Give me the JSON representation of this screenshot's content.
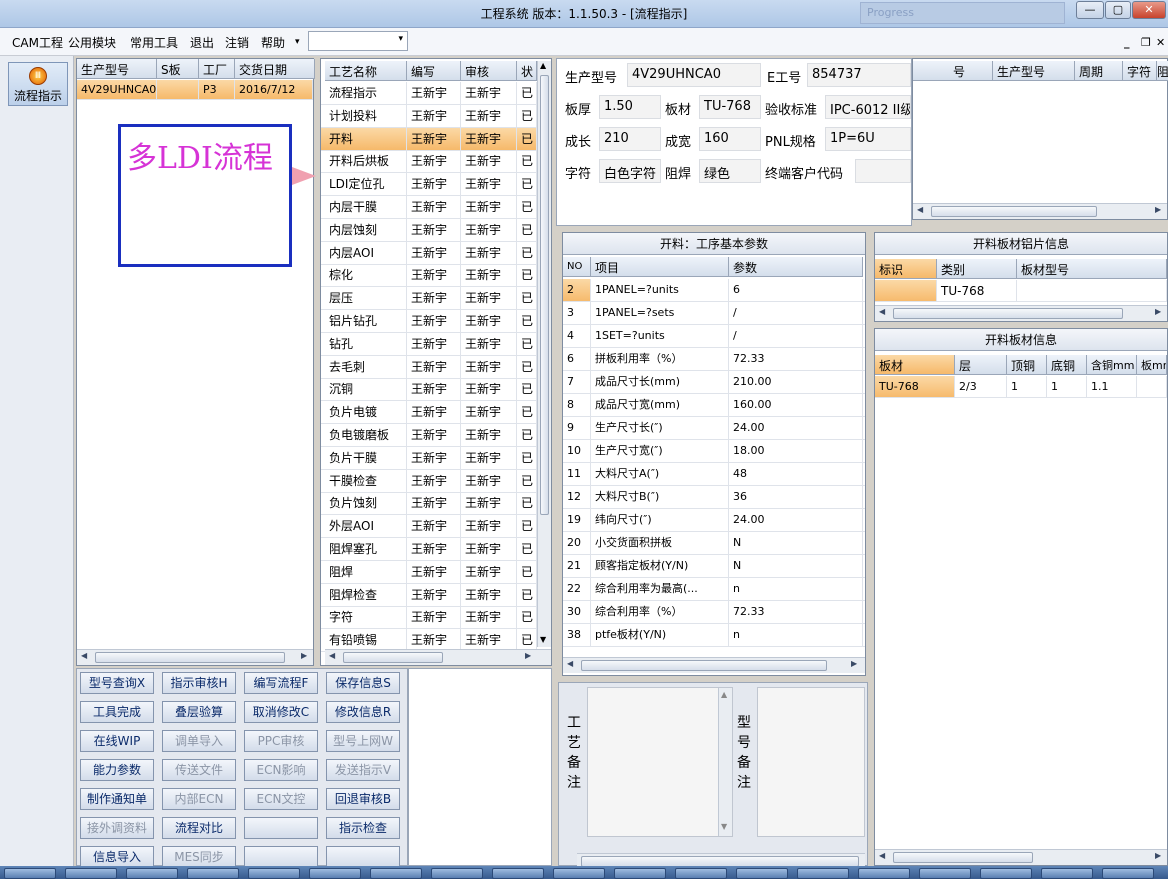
{
  "window": {
    "title": "工程系统   版本：1.1.50.3 - [流程指示]",
    "ghost_title": "Progress",
    "min": "—",
    "max": "▢",
    "close": "✕"
  },
  "menu": {
    "items": [
      "CAM工程",
      "公用模块",
      "常用工具",
      "退出",
      "注销",
      "帮助"
    ],
    "dropdown_arrow": "▾",
    "mdi_min": "_",
    "mdi_restore": "❐",
    "mdi_close": "✕"
  },
  "leftbar": {
    "flow_btn": "流程指示",
    "icon": "flow-indicator-icon"
  },
  "order_table": {
    "headers": [
      "生产型号",
      "S板",
      "工厂",
      "交货日期"
    ],
    "rows": [
      [
        "4V29UHNCA0",
        "",
        "P3",
        "2016/7/12"
      ]
    ]
  },
  "note_box": {
    "text": "多LDI流程"
  },
  "process_table": {
    "headers": [
      "工艺名称",
      "编写",
      "审核",
      "状"
    ],
    "rows": [
      [
        "流程指示",
        "王新宇",
        "王新宇",
        "已"
      ],
      [
        "计划投料",
        "王新宇",
        "王新宇",
        "已"
      ],
      [
        "开料",
        "王新宇",
        "王新宇",
        "已"
      ],
      [
        "开料后烘板",
        "王新宇",
        "王新宇",
        "已"
      ],
      [
        "LDI定位孔",
        "王新宇",
        "王新宇",
        "已"
      ],
      [
        "内层干膜",
        "王新宇",
        "王新宇",
        "已"
      ],
      [
        "内层蚀刻",
        "王新宇",
        "王新宇",
        "已"
      ],
      [
        "内层AOI",
        "王新宇",
        "王新宇",
        "已"
      ],
      [
        "棕化",
        "王新宇",
        "王新宇",
        "已"
      ],
      [
        "层压",
        "王新宇",
        "王新宇",
        "已"
      ],
      [
        "铝片钻孔",
        "王新宇",
        "王新宇",
        "已"
      ],
      [
        "钻孔",
        "王新宇",
        "王新宇",
        "已"
      ],
      [
        "去毛刺",
        "王新宇",
        "王新宇",
        "已"
      ],
      [
        "沉铜",
        "王新宇",
        "王新宇",
        "已"
      ],
      [
        "负片电镀",
        "王新宇",
        "王新宇",
        "已"
      ],
      [
        "负电镀磨板",
        "王新宇",
        "王新宇",
        "已"
      ],
      [
        "负片干膜",
        "王新宇",
        "王新宇",
        "已"
      ],
      [
        "干膜检查",
        "王新宇",
        "王新宇",
        "已"
      ],
      [
        "负片蚀刻",
        "王新宇",
        "王新宇",
        "已"
      ],
      [
        "外层AOI",
        "王新宇",
        "王新宇",
        "已"
      ],
      [
        "阻焊塞孔",
        "王新宇",
        "王新宇",
        "已"
      ],
      [
        "阻焊",
        "王新宇",
        "王新宇",
        "已"
      ],
      [
        "阻焊检查",
        "王新宇",
        "王新宇",
        "已"
      ],
      [
        "字符",
        "王新宇",
        "王新宇",
        "已"
      ],
      [
        "有铅喷锡",
        "王新宇",
        "王新宇",
        "已"
      ]
    ],
    "selected": 2
  },
  "buttons": [
    {
      "label": "型号查询X",
      "disabled": false
    },
    {
      "label": "指示审核H",
      "disabled": false
    },
    {
      "label": "编写流程F",
      "disabled": false
    },
    {
      "label": "保存信息S",
      "disabled": false
    },
    {
      "label": "工具完成",
      "disabled": false
    },
    {
      "label": "叠层验算",
      "disabled": false
    },
    {
      "label": "取消修改C",
      "disabled": false
    },
    {
      "label": "修改信息R",
      "disabled": false
    },
    {
      "label": "在线WIP",
      "disabled": false
    },
    {
      "label": "调单导入",
      "disabled": true
    },
    {
      "label": "PPC审核",
      "disabled": true
    },
    {
      "label": "型号上网W",
      "disabled": true
    },
    {
      "label": "能力参数",
      "disabled": false
    },
    {
      "label": "传送文件",
      "disabled": true
    },
    {
      "label": "ECN影响",
      "disabled": true
    },
    {
      "label": "发送指示V",
      "disabled": true
    },
    {
      "label": "制作通知单",
      "disabled": false
    },
    {
      "label": "内部ECN",
      "disabled": true
    },
    {
      "label": "ECN文控",
      "disabled": true
    },
    {
      "label": "回退审核B",
      "disabled": false
    },
    {
      "label": "接外调资料",
      "disabled": true
    },
    {
      "label": "流程对比",
      "disabled": false
    },
    {
      "label": "",
      "disabled": false
    },
    {
      "label": "指示检查",
      "disabled": false
    },
    {
      "label": "信息导入",
      "disabled": false
    },
    {
      "label": "MES同步",
      "disabled": true
    },
    {
      "label": "",
      "disabled": false
    },
    {
      "label": "",
      "disabled": false
    }
  ],
  "info": {
    "model_label": "生产型号",
    "model": "4V29UHNCA0",
    "eng_label": "E工号",
    "eng": "854737",
    "thick_label": "板厚",
    "thick": "1.50",
    "mat_label": "板材",
    "mat": "TU-768",
    "std_label": "验收标准",
    "std": "IPC-6012 II级",
    "len_label": "成长",
    "len": "210",
    "wid_label": "成宽",
    "wid": "160",
    "pnl_label": "PNL规格",
    "pnl": "1P=6U",
    "char_label": "字符",
    "char": "白色字符",
    "mask_label": "阻焊",
    "mask": "绿色",
    "cust_label": "终端客户代码",
    "cust": ""
  },
  "top_right_table": {
    "headers": [
      "号",
      "生产型号",
      "周期",
      "字符",
      "阻"
    ]
  },
  "params": {
    "title": "开料：工序基本参数",
    "headers": [
      "NO",
      "项目",
      "参数"
    ],
    "rows": [
      [
        "2",
        "1PANEL=?units",
        "6"
      ],
      [
        "3",
        "1PANEL=?sets",
        "/"
      ],
      [
        "4",
        "1SET=?units",
        "/"
      ],
      [
        "6",
        "拼板利用率（%）",
        "72.33"
      ],
      [
        "7",
        "成品尺寸长(mm)",
        "210.00"
      ],
      [
        "8",
        "成品尺寸宽(mm)",
        "160.00"
      ],
      [
        "9",
        "生产尺寸长(″)",
        "24.00"
      ],
      [
        "10",
        "生产尺寸宽(″)",
        "18.00"
      ],
      [
        "11",
        "大料尺寸A(″)",
        "48"
      ],
      [
        "12",
        "大料尺寸B(″)",
        "36"
      ],
      [
        "19",
        "纬向尺寸(″)",
        "24.00"
      ],
      [
        "20",
        "小交货面积拼板",
        "N"
      ],
      [
        "21",
        "顾客指定板材(Y/N)",
        "N"
      ],
      [
        "22",
        "综合利用率为最高(...",
        "n"
      ],
      [
        "30",
        "综合利用率（%）",
        "72.33"
      ],
      [
        "38",
        "ptfe板材(Y/N)",
        "n"
      ]
    ]
  },
  "alu": {
    "title": "开料板材铝片信息",
    "headers": [
      "标识",
      "类别",
      "板材型号"
    ],
    "rows": [
      [
        "",
        "TU-768",
        ""
      ]
    ]
  },
  "board": {
    "title": "开料板材信息",
    "headers": [
      "板材",
      "层",
      "顶铜",
      "底铜",
      "含铜mm",
      "板mm"
    ],
    "rows": [
      [
        "TU-768",
        "2/3",
        "1",
        "1",
        "1.1",
        ""
      ]
    ]
  },
  "remarks": {
    "process_label": "工艺备注",
    "model_label": "型号备注"
  }
}
